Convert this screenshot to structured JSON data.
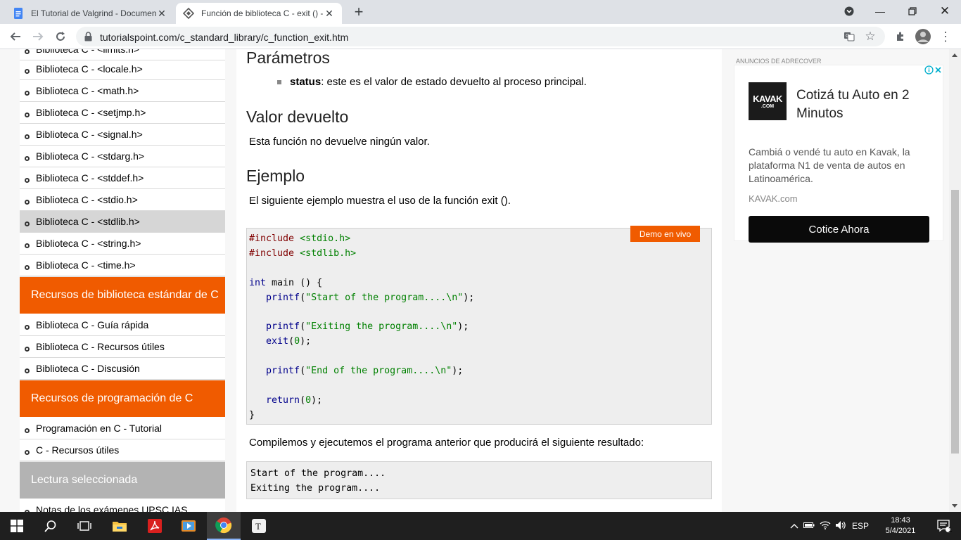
{
  "browser": {
    "tabs": [
      {
        "title": "El Tutorial de Valgrind - Documen",
        "active": false
      },
      {
        "title": "Función de biblioteca C - exit () -",
        "active": true
      }
    ],
    "url": "tutorialspoint.com/c_standard_library/c_function_exit.htm"
  },
  "sidebar": {
    "top_partial": "Biblioteca C - <limits.h>",
    "std_items": [
      "Biblioteca C - <locale.h>",
      "Biblioteca C - <math.h>",
      "Biblioteca C - <setjmp.h>",
      "Biblioteca C - <signal.h>",
      "Biblioteca C - <stdarg.h>",
      "Biblioteca C - <stddef.h>",
      "Biblioteca C - <stdio.h>",
      "Biblioteca C - <stdlib.h>",
      "Biblioteca C - <string.h>",
      "Biblioteca C - <time.h>"
    ],
    "selected_item": "Biblioteca C - <stdlib.h>",
    "section_resources": "Recursos de biblioteca estándar de C",
    "resource_items": [
      "Biblioteca C - Guía rápida",
      "Biblioteca C - Recursos útiles",
      "Biblioteca C - Discusión"
    ],
    "section_programming": "Recursos de programación de C",
    "programming_items": [
      "Programación en C - Tutorial",
      "C - Recursos útiles"
    ],
    "section_reading": "Lectura seleccionada",
    "reading_items": [
      "Notas de los exámenes UPSC IAS"
    ]
  },
  "content": {
    "h_params": "Parámetros",
    "param_name": "status",
    "param_desc": " : este es el valor de estado devuelto al proceso principal.",
    "h_return": "Valor devuelto",
    "return_text": "Esta función no devuelve ningún valor.",
    "h_example": "Ejemplo",
    "example_text": "El siguiente ejemplo muestra el uso de la función exit ().",
    "demo_button": "Demo en vivo",
    "code_lines": [
      "#include <stdio.h>",
      "#include <stdlib.h>",
      "",
      "int main () {",
      "   printf(\"Start of the program....\\n\");",
      "",
      "   printf(\"Exiting the program....\\n\");",
      "   exit(0);",
      "",
      "   printf(\"End of the program....\\n\");",
      "",
      "   return(0);",
      "}"
    ],
    "compile_text": "Compilemos y ejecutemos el programa anterior que producirá el siguiente resultado:",
    "output_lines": [
      "Start of the program....",
      "Exiting the program...."
    ]
  },
  "ad": {
    "label": "ANUNCIOS DE ADRECOVER",
    "logo_text": "KAVAK",
    "logo_sub": ".COM",
    "headline": "Cotizá tu Auto en 2 Minutos",
    "body": "Cambiá o vendé tu auto en Kavak, la plataforma N1 de venta de autos en Latinoamérica.",
    "url": "KAVAK.com",
    "cta": "Cotice Ahora"
  },
  "taskbar": {
    "lang": "ESP",
    "time": "18:43",
    "date": "5/4/2021",
    "notifications": "1"
  },
  "colors": {
    "accent_orange": "#f05b00",
    "section_gray": "#b3b3b3",
    "chrome_tabstrip": "#dee1e6"
  }
}
